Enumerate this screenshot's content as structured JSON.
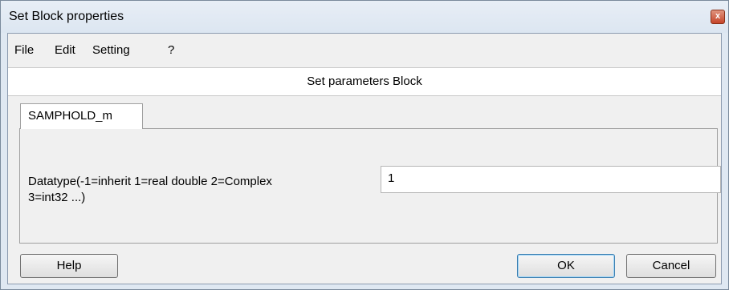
{
  "window": {
    "title": "Set Block properties",
    "close_glyph": "x"
  },
  "menu": {
    "items": [
      {
        "label": "File"
      },
      {
        "label": "Edit"
      },
      {
        "label": "Setting"
      },
      {
        "label": "?"
      }
    ]
  },
  "header": {
    "title": "Set parameters Block"
  },
  "tabs": [
    {
      "label": "SAMPHOLD_m",
      "selected": true
    }
  ],
  "parameters": [
    {
      "label_line1": "Datatype(-1=inherit 1=real double 2=Complex",
      "label_line2": "3=int32 ...)",
      "value": "1"
    }
  ],
  "buttons": {
    "help": "Help",
    "ok": "OK",
    "cancel": "Cancel"
  }
}
